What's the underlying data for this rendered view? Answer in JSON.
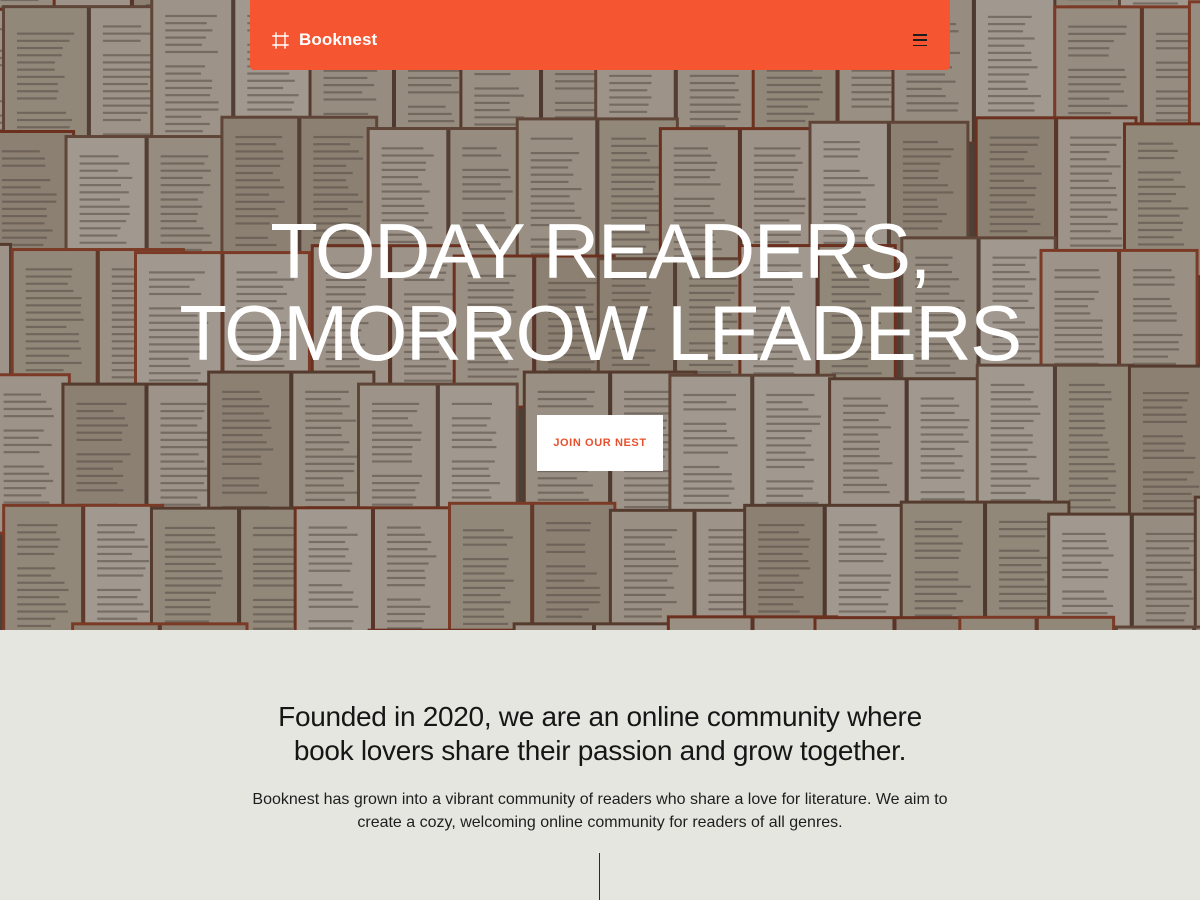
{
  "colors": {
    "accent": "#f55530",
    "page_background": "#e6e6e0",
    "hero_title": "#ffffff",
    "cta_text": "#e8502c"
  },
  "nav": {
    "brand_icon": "frame-icon",
    "brand_name": "Booknest",
    "menu_icon": "hamburger-menu-icon"
  },
  "hero": {
    "background_image": "open-books-wall",
    "title_line1": "TODAY READERS,",
    "title_line2": "TOMORROW LEADERS",
    "cta_label": "JOIN OUR NEST"
  },
  "about": {
    "heading_line1": "Founded in 2020, we are an online community where",
    "heading_line2": "book lovers share their passion and grow together.",
    "body_line1": "Booknest has grown into a vibrant community of readers who share a love for literature. We aim to",
    "body_line2": "create a cozy, welcoming online community for readers of all genres."
  }
}
